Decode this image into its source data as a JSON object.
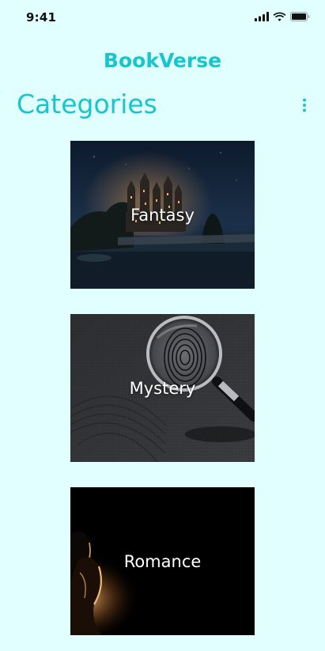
{
  "status_bar": {
    "time": "9:41",
    "icons": [
      "cellular-signal-icon",
      "wifi-icon",
      "battery-icon"
    ]
  },
  "header": {
    "app_title": "BookVerse"
  },
  "main": {
    "page_title": "Categories",
    "menu_icon": "more-vertical-icon",
    "categories": [
      {
        "label": "Fantasy",
        "image": "castle-at-night"
      },
      {
        "label": "Mystery",
        "image": "magnifying-glass-fingerprint"
      },
      {
        "label": "Romance",
        "image": "couple-silhouette"
      }
    ]
  },
  "colors": {
    "background": "#e0fffe",
    "accent": "#17c5cd",
    "status_text": "#111111"
  }
}
